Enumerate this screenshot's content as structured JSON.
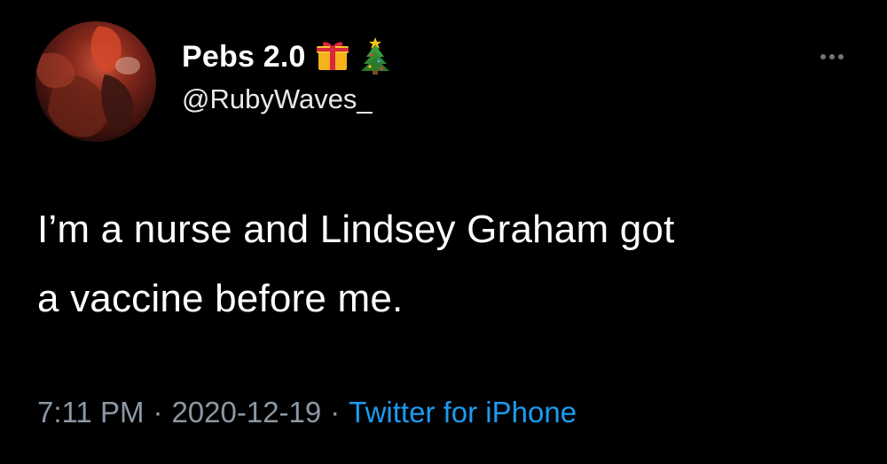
{
  "tweet": {
    "author": {
      "display_name": "Pebs 2.0",
      "handle": "@RubyWaves_",
      "name_emojis": [
        "gift-icon",
        "christmas-tree-icon"
      ]
    },
    "text_lines": [
      "I’m a nurse and Lindsey Graham got",
      "a vaccine before me."
    ],
    "meta": {
      "time": "7:11 PM",
      "separator": "·",
      "date": "2020-12-19",
      "source": "Twitter for iPhone"
    },
    "colors": {
      "background": "#000000",
      "text": "#ffffff",
      "secondary": "#8b98a5",
      "link": "#1d9bf0"
    }
  }
}
